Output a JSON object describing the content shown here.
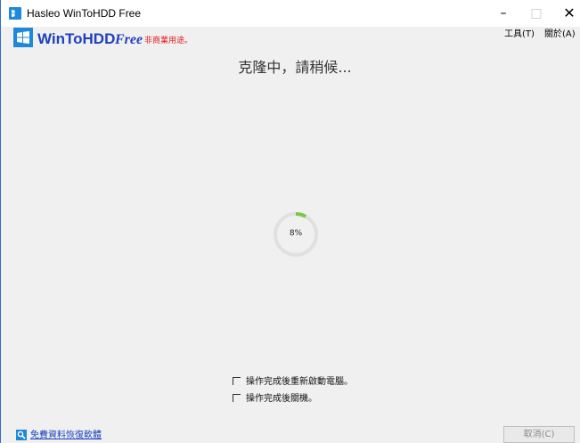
{
  "window": {
    "title": "Hasleo WinToHDD Free",
    "controls": {
      "minimize": "–",
      "maximize": "□",
      "close": "✕"
    }
  },
  "header": {
    "brand": "WinToHDD",
    "brand_edition": "Free",
    "brand_note": "非商業用途。",
    "menu": {
      "tools": "工具(T)",
      "about": "關於(A)"
    }
  },
  "main": {
    "status_title": "克隆中，請稍候...",
    "progress": {
      "percent": 8,
      "label": "8%"
    },
    "options": [
      {
        "label": "操作完成後重新啟動電腦。",
        "checked": false
      },
      {
        "label": "操作完成後關機。",
        "checked": false
      }
    ]
  },
  "footer": {
    "link_label": "免費資料恢復軟體",
    "cancel_label": "取消(C)"
  },
  "colors": {
    "accent": "#1e88d9",
    "brand": "#1f3fbf",
    "note": "#e02020",
    "progress": "#7ac943",
    "ring_track": "#e0e0e0"
  },
  "icons": {
    "app": "windows-logo-icon",
    "link": "search-icon"
  }
}
